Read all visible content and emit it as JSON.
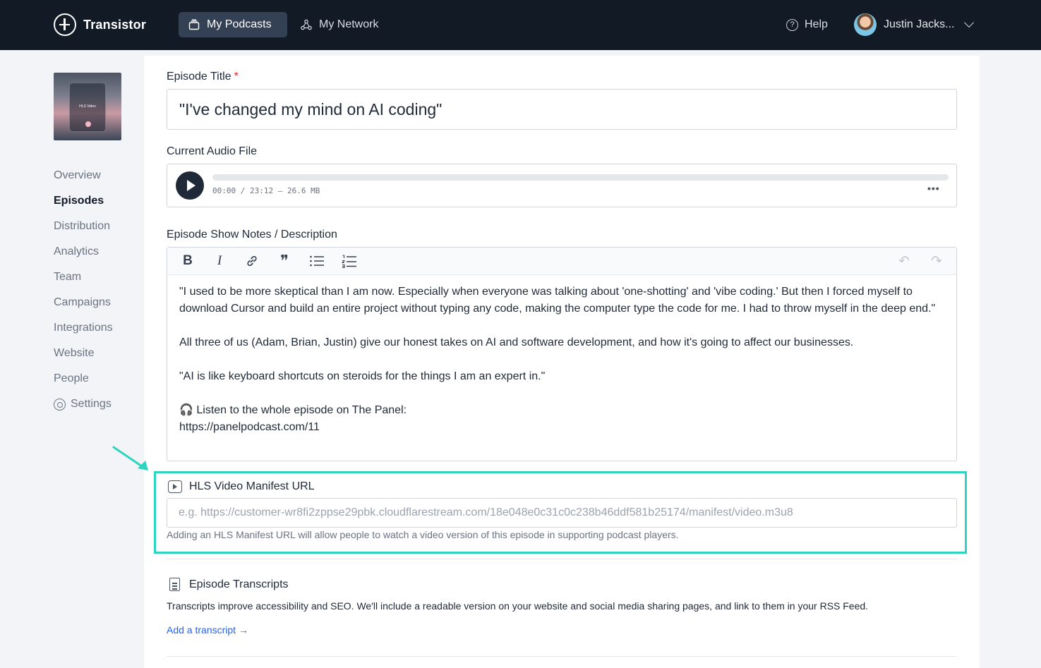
{
  "app": {
    "brand": "Transistor"
  },
  "nav": {
    "podcasts": "My Podcasts",
    "network": "My Network",
    "help": "Help",
    "user_name": "Justin Jacks..."
  },
  "cover": {
    "title": "HLS Video"
  },
  "sidebar": {
    "items": [
      {
        "label": "Overview"
      },
      {
        "label": "Episodes",
        "active": true
      },
      {
        "label": "Distribution"
      },
      {
        "label": "Analytics"
      },
      {
        "label": "Team"
      },
      {
        "label": "Campaigns"
      },
      {
        "label": "Integrations"
      },
      {
        "label": "Website"
      },
      {
        "label": "People"
      },
      {
        "label": "Settings",
        "icon": "gear-icon"
      }
    ]
  },
  "episode": {
    "title_label": "Episode Title",
    "required_mark": "*",
    "title_value": "\"I've changed my mind on AI coding\"",
    "audio_label": "Current Audio File",
    "audio_time": "00:00 / 23:12 — 26.6 MB",
    "audio_menu": "•••",
    "notes_label": "Episode Show Notes / Description",
    "notes": {
      "p1": "\"I used to be more skeptical than I am now. Especially when everyone was talking about 'one-shotting' and 'vibe coding.' But then I forced myself to download Cursor and build an entire project without typing any code, making the computer type the code for me. I had to throw myself in the deep end.\"",
      "p2": "All three of us (Adam, Brian, Justin) give our honest takes on AI and software development, and how it's going to affect our businesses.",
      "p3": "\"AI is like keyboard shortcuts on steroids for the things I am an expert in.\"",
      "p4_line1": "🎧 Listen to the whole episode on The Panel:",
      "p4_line2": "https://panelpodcast.com/11"
    },
    "toolbar": {
      "bold": "B",
      "italic": "I",
      "quote": "❞",
      "undo": "↶",
      "redo": "↷"
    }
  },
  "hls": {
    "label": "HLS Video Manifest URL",
    "placeholder": "e.g. https://customer-wr8fi2zppse29pbk.cloudflarestream.com/18e048e0c31c0c238b46ddf581b25174/manifest/video.m3u8",
    "help": "Adding an HLS Manifest URL will allow people to watch a video version of this episode in supporting podcast players.",
    "highlight_color": "#2dd4bf"
  },
  "transcripts": {
    "label": "Episode Transcripts",
    "description": "Transcripts improve accessibility and SEO. We'll include a readable version on your website and social media sharing pages, and link to them in your RSS Feed.",
    "link": "Add a transcript →"
  }
}
